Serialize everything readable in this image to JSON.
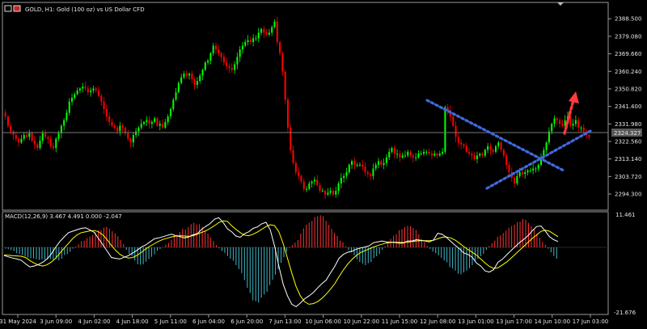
{
  "window": {
    "title": "GOLD, H1:  Gold (100 oz) vs US Dollar CFD",
    "current_price": "2324.327"
  },
  "indicator": {
    "title": "MACD(12,26,9) 3.467 4.491 0.000 -2.047",
    "top_label": "11.461",
    "bottom_label": "-21.676"
  },
  "colors": {
    "background": "#000000",
    "bull": "#00ff00",
    "bear": "#ff0000",
    "trendline": "#4169e1",
    "arrow": "#ff3333",
    "hist_pos": "#ff3333",
    "hist_neg": "#3fb8c8",
    "macd_line": "#ffffff",
    "signal_line": "#ffff00",
    "axis_text": "#e6e6e6"
  },
  "chart_data": {
    "type": "line",
    "title": "GOLD, H1:  Gold (100 oz) vs US Dollar CFD",
    "price_axis": {
      "ylim": [
        2289.1,
        2391.2
      ],
      "ticks": [
        "2388.500",
        "2379.080",
        "2369.660",
        "2360.240",
        "2350.820",
        "2341.400",
        "2331.980",
        "2322.560",
        "2313.140",
        "2303.720",
        "2294.300"
      ]
    },
    "time_axis": {
      "ticks": [
        "31 May 2024",
        "3 Jun 09:00",
        "4 Jun 02:00",
        "4 Jun 18:00",
        "5 Jun 11:00",
        "6 Jun 04:00",
        "6 Jun 20:00",
        "7 Jun 13:00",
        "10 Jun 06:00",
        "10 Jun 22:00",
        "11 Jun 15:00",
        "12 Jun 08:00",
        "13 Jun 01:00",
        "13 Jun 17:00",
        "14 Jun 10:00",
        "17 Jun 03:00"
      ]
    },
    "series": [
      {
        "values": [
          2336,
          2331,
          2328,
          2326,
          2324,
          2322,
          2324,
          2326,
          2325,
          2327,
          2323,
          2321,
          2319,
          2323,
          2327,
          2325,
          2324,
          2320,
          2319,
          2324,
          2327,
          2331,
          2334,
          2338,
          2344,
          2346,
          2348,
          2350,
          2351,
          2352,
          2351,
          2349,
          2350,
          2351,
          2350,
          2347,
          2344,
          2340,
          2336,
          2333,
          2331,
          2330,
          2328,
          2331,
          2330,
          2327,
          2324,
          2322,
          2326,
          2328,
          2330,
          2332,
          2333,
          2334,
          2332,
          2333,
          2335,
          2331,
          2332,
          2330,
          2333,
          2336,
          2340,
          2345,
          2349,
          2354,
          2357,
          2359,
          2358,
          2359,
          2356,
          2353,
          2355,
          2358,
          2361,
          2365,
          2366,
          2370,
          2374,
          2372,
          2370,
          2368,
          2365,
          2363,
          2362,
          2361,
          2364,
          2368,
          2372,
          2374,
          2376,
          2377,
          2376,
          2378,
          2378,
          2381,
          2383,
          2381,
          2380,
          2381,
          2384,
          2387,
          2376,
          2370,
          2360,
          2345,
          2330,
          2318,
          2311,
          2306,
          2304,
          2301,
          2297,
          2297,
          2300,
          2301,
          2302,
          2299,
          2296,
          2296,
          2294,
          2295,
          2296,
          2294,
          2296,
          2300,
          2303,
          2304,
          2306,
          2310,
          2312,
          2310,
          2310,
          2310,
          2309,
          2306,
          2305,
          2304,
          2308,
          2310,
          2312,
          2310,
          2311,
          2314,
          2317,
          2319,
          2316,
          2316,
          2314,
          2315,
          2315,
          2317,
          2315,
          2314,
          2314,
          2316,
          2316,
          2317,
          2317,
          2316,
          2315,
          2316,
          2315,
          2316,
          2317,
          2341,
          2339,
          2336,
          2331,
          2325,
          2322,
          2321,
          2320,
          2317,
          2316,
          2315,
          2313,
          2315,
          2316,
          2315,
          2318,
          2320,
          2318,
          2317,
          2320,
          2322,
          2318,
          2315,
          2310,
          2306,
          2303,
          2300,
          2304,
          2306,
          2305,
          2306,
          2307,
          2307,
          2308,
          2308,
          2310,
          2314,
          2318,
          2322,
          2328,
          2332,
          2335,
          2334,
          2332,
          2331,
          2334,
          2336,
          2331,
          2332,
          2334,
          2330,
          2330,
          2328,
          2326,
          2325
        ]
      },
      {
        "name": "MACD",
        "values": [
          -2.7,
          -3.1,
          -3.5,
          -3.8,
          -4.2,
          -5.4,
          -6.4,
          -6.1,
          -5.6,
          -4.9,
          -3.8,
          -2.2,
          0,
          1.9,
          3.4,
          4.8,
          5.3,
          5.8,
          6.2,
          6.4,
          5.7,
          4.9,
          2.9,
          0.9,
          -1.2,
          -3.3,
          -3.6,
          -3.8,
          -3.2,
          -2.7,
          -1.8,
          -0.9,
          0.1,
          0.8,
          1.8,
          2.8,
          3.1,
          3.5,
          3.9,
          4.3,
          3.8,
          3.5,
          3.1,
          3.4,
          4.1,
          4.5,
          5.9,
          6.9,
          7.8,
          9.2,
          9.7,
          8.2,
          6.1,
          5.1,
          3.7,
          3.3,
          4.5,
          5.1,
          6.2,
          6.7,
          7.7,
          8.2,
          5.7,
          0.4,
          -6.1,
          -12.1,
          -15.9,
          -18.6,
          -19.4,
          -18.2,
          -16.8,
          -15.9,
          -14.8,
          -13.3,
          -11.9,
          -10.7,
          -8.4,
          -6.2,
          -3.6,
          -2.3,
          -1.6,
          -1.3,
          -0.6,
          -0.2,
          0.1,
          0.5,
          1.5,
          1.8,
          2.1,
          1.8,
          1.7,
          1.6,
          1.4,
          1.4,
          2.1,
          2.1,
          2.5,
          2.3,
          2.1,
          1.8,
          2.4,
          4.6,
          4.3,
          3.3,
          2,
          0.7,
          -0.4,
          -1.8,
          -2.3,
          -3.2,
          -5.1,
          -6.1,
          -7.7,
          -8.1,
          -7.3,
          -4.9,
          -3.9,
          -2.5,
          -1.1,
          0.2,
          1.5,
          2.6,
          3.8,
          5.4,
          6.8,
          7,
          5.4,
          3.5,
          2.5,
          1.9
        ]
      },
      {
        "name": "Signal",
        "values": [
          -2.5,
          -2.6,
          -2.7,
          -2.8,
          -2.9,
          -3.3,
          -4.3,
          -5.1,
          -5.8,
          -6.1,
          -5.7,
          -4.8,
          -3.6,
          -1.9,
          -0.3,
          1.3,
          2.9,
          4.1,
          4.8,
          5.1,
          5.4,
          5.5,
          5.1,
          4.1,
          2.5,
          0.6,
          -1,
          -2.3,
          -3.1,
          -3.5,
          -3.3,
          -2.6,
          -1.6,
          -0.5,
          0.4,
          1.2,
          2,
          2.6,
          3,
          3.4,
          3.7,
          3.8,
          3.7,
          3.6,
          3.8,
          4.3,
          4.9,
          5.4,
          6.2,
          7.1,
          8.1,
          8.7,
          8.5,
          7.1,
          5.9,
          4.8,
          4,
          3.8,
          4.3,
          5,
          5.9,
          6.8,
          7.4,
          7.1,
          5.1,
          1.2,
          -3.6,
          -8.4,
          -12.8,
          -15.9,
          -17.8,
          -18.6,
          -18.4,
          -17.8,
          -16.7,
          -15.3,
          -13.7,
          -11.9,
          -9.6,
          -7.4,
          -5.5,
          -4,
          -2.7,
          -1.7,
          -1.1,
          -0.5,
          0.1,
          0.6,
          1,
          1.4,
          1.6,
          1.7,
          1.6,
          1.6,
          1.7,
          1.9,
          2.1,
          2.2,
          2.2,
          2.2,
          2.3,
          2.8,
          3.3,
          3.4,
          3.1,
          2.4,
          1.4,
          0.3,
          -0.7,
          -1.6,
          -2.5,
          -3.8,
          -5.1,
          -6.2,
          -6.9,
          -6.7,
          -5.8,
          -4.8,
          -3.6,
          -2.3,
          -1,
          0.3,
          1.6,
          2.9,
          4,
          5.2,
          5.6,
          5.3,
          4.4,
          3.5
        ]
      },
      {
        "name": "Histogram",
        "values": [
          -0.4,
          -0.6,
          -0.9,
          -1.2,
          -1.9,
          -2.2,
          -2.5,
          -2.9,
          -3.3,
          -3.6,
          -3.6,
          -3.9,
          -4.1,
          -3.9,
          -4,
          -3.9,
          -3.8,
          -4.1,
          -3.8,
          -4.3,
          -3.7,
          -2.5,
          -2.2,
          -1.4,
          -0.4,
          0.3,
          1,
          2,
          2.2,
          3,
          3.5,
          4,
          5,
          5.5,
          5.6,
          6.5,
          6.7,
          6.1,
          5.3,
          4.6,
          3.6,
          2.4,
          1.1,
          -0.8,
          -2.2,
          -2.8,
          -4.3,
          -5.5,
          -5.7,
          -5.5,
          -4.7,
          -3.8,
          -3.1,
          -2.3,
          -1.1,
          -0.5,
          0.1,
          0.9,
          1.5,
          2.5,
          3.7,
          4.2,
          5,
          6,
          5.8,
          6.6,
          7.6,
          8,
          7.5,
          7.6,
          6.7,
          5.6,
          4.5,
          3.2,
          2.1,
          0.7,
          -0.3,
          -1.2,
          -1.8,
          -2.8,
          -3.7,
          -4.4,
          -5.8,
          -7.1,
          -8.4,
          -10.7,
          -13.2,
          -14.9,
          -17.3,
          -17.6,
          -18,
          -16.5,
          -15.4,
          -14.6,
          -12.3,
          -10.6,
          -8.9,
          -7.2,
          -5.1,
          -3.2,
          -1.4,
          -0.2,
          0.7,
          1.5,
          2.4,
          4.5,
          6.2,
          7.4,
          8.1,
          8.7,
          9.9,
          10.2,
          10.5,
          10.2,
          8.7,
          7.4,
          6,
          4.7,
          3.7,
          2.2,
          1.7,
          0.3,
          -0.9,
          -1.6,
          -2.6,
          -3.9,
          -4.8,
          -5.3,
          -5.8,
          -5.2,
          -4.8,
          -3.5,
          -2.9,
          -2.2,
          -0.8,
          0.4,
          1.6,
          2.8,
          3.8,
          4.3,
          5.6,
          6,
          6.6,
          7,
          6.9,
          6.3,
          5.7,
          4.3,
          2.7,
          1.7,
          0.4,
          -0.5,
          -1.4,
          -1.9,
          -2.6,
          -3.4,
          -4.3,
          -4.9,
          -6.5,
          -6.9,
          -7.6,
          -8.6,
          -8.8,
          -8.2,
          -7.6,
          -6.8,
          -5.8,
          -4.6,
          -3.8,
          -2.9,
          -2.1,
          -0.8,
          0.4,
          1.3,
          2.2,
          3.5,
          4,
          4.7,
          5.5,
          6.4,
          7,
          7.4,
          8.3,
          8.4,
          9.3,
          9,
          8,
          7,
          6,
          4.5,
          3.1,
          1.8,
          0.8,
          -0.4,
          -1.6,
          -2.8,
          -3.7
        ]
      }
    ],
    "macd_axis": {
      "ylim": [
        -21.676,
        11.461
      ]
    }
  }
}
